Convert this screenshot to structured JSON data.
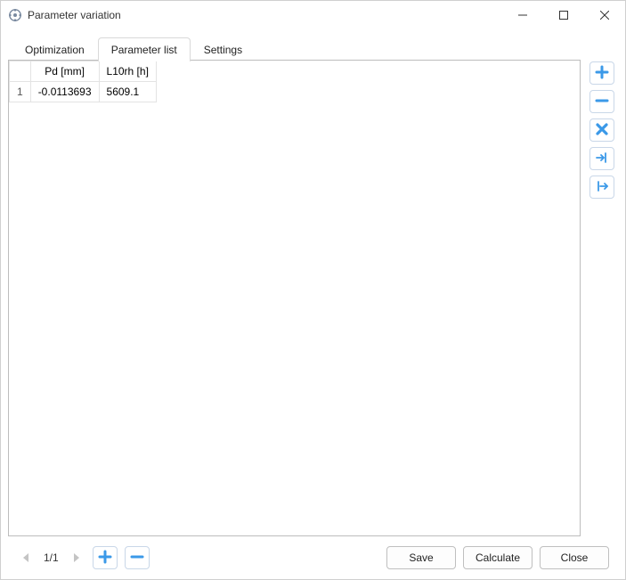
{
  "window": {
    "title": "Parameter variation"
  },
  "tabs": [
    {
      "id": "optimization",
      "label": "Optimization"
    },
    {
      "id": "parameter-list",
      "label": "Parameter list"
    },
    {
      "id": "settings",
      "label": "Settings"
    }
  ],
  "active_tab": "parameter-list",
  "table": {
    "columns": [
      "Pd [mm]",
      "L10rh [h]"
    ],
    "rows": [
      {
        "index": "1",
        "cells": [
          "-0.0113693",
          "5609.1"
        ]
      }
    ]
  },
  "side_tools": [
    {
      "id": "add",
      "icon": "plus-icon"
    },
    {
      "id": "remove",
      "icon": "minus-icon"
    },
    {
      "id": "delete",
      "icon": "cross-icon"
    },
    {
      "id": "import",
      "icon": "arrow-in-icon"
    },
    {
      "id": "export",
      "icon": "arrow-out-icon"
    }
  ],
  "footer": {
    "page_indicator": "1/1",
    "buttons": {
      "save": "Save",
      "calculate": "Calculate",
      "close": "Close"
    }
  },
  "colors": {
    "accent": "#3b99e8"
  }
}
